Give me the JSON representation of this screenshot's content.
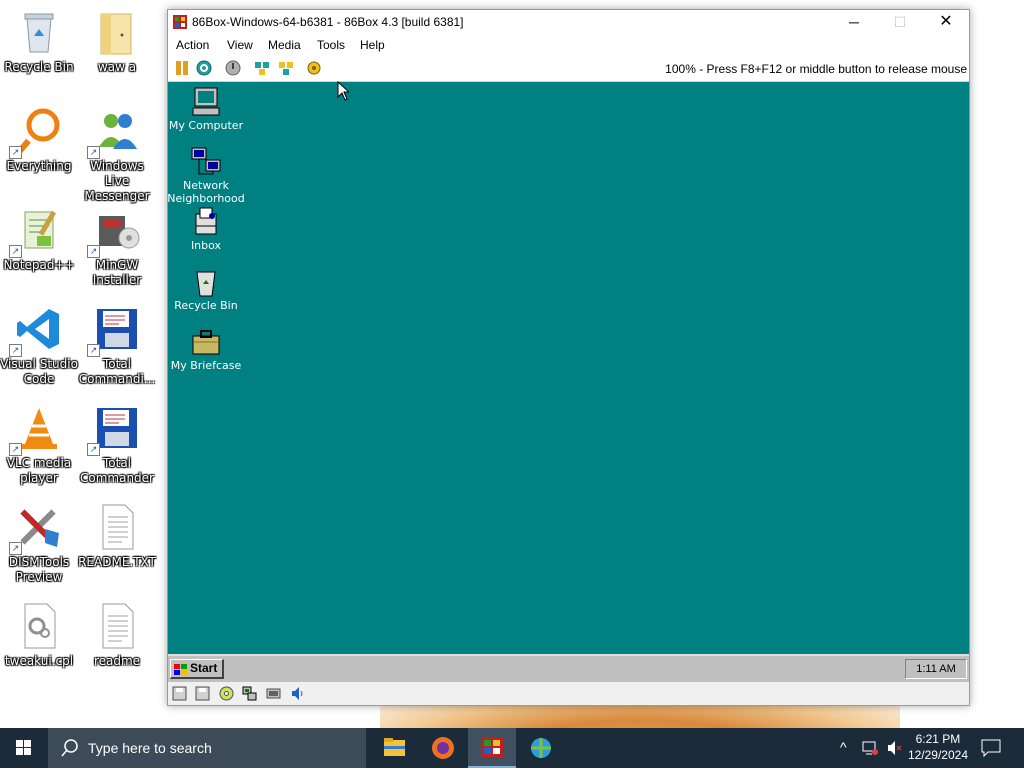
{
  "host_desktop": {
    "icons": [
      {
        "label": "Recycle Bin",
        "icon": "recycle-bin-icon"
      },
      {
        "label": "waw a",
        "icon": "folder-icon"
      },
      {
        "label": "Everything",
        "icon": "magnifier-app-icon"
      },
      {
        "label": "Windows Live Messenger",
        "icon": "messenger-icon"
      },
      {
        "label": "Notepad++",
        "icon": "notepadpp-icon"
      },
      {
        "label": "MinGW Installer",
        "icon": "installer-icon"
      },
      {
        "label": "Visual Studio Code",
        "icon": "vscode-icon"
      },
      {
        "label": "Total Commandi...",
        "icon": "floppy-icon"
      },
      {
        "label": "VLC media player",
        "icon": "vlc-icon"
      },
      {
        "label": "Total Commander",
        "icon": "floppy-icon"
      },
      {
        "label": "DISMTools Preview",
        "icon": "tools-icon"
      },
      {
        "label": "README.TXT",
        "icon": "text-file-icon"
      },
      {
        "label": "tweakui.cpl",
        "icon": "cpl-file-icon"
      },
      {
        "label": "readme",
        "icon": "text-file-icon"
      }
    ]
  },
  "emulator": {
    "title": "86Box-Windows-64-b6381 - 86Box 4.3 [build 6381]",
    "menu": [
      "Action",
      "View",
      "Media",
      "Tools",
      "Help"
    ],
    "status_text": "100% - Press F8+F12 or middle button to release mouse",
    "toolbar_icons": [
      "pause-icon",
      "reset-icon",
      "power-icon",
      "ctrl-alt-del-icon",
      "ctrl-alt-esc-icon",
      "settings-icon"
    ],
    "statusbar_icons": [
      "floppy-drive-icon",
      "floppy-drive-icon",
      "cdrom-icon",
      "network-icon",
      "display-icon",
      "sound-icon"
    ]
  },
  "guest": {
    "background": "#008080",
    "icons": [
      {
        "label": "My Computer",
        "icon": "my-computer-icon"
      },
      {
        "label": "Network Neighborhood",
        "icon": "network-neighborhood-icon"
      },
      {
        "label": "Inbox",
        "icon": "inbox-icon"
      },
      {
        "label": "Recycle Bin",
        "icon": "recycle-bin-icon"
      },
      {
        "label": "My Briefcase",
        "icon": "briefcase-icon"
      }
    ],
    "start_label": "Start",
    "clock": "1:11 AM"
  },
  "host_taskbar": {
    "search_placeholder": "Type here to search",
    "apps": [
      "file-explorer-icon",
      "firefox-icon",
      "86box-icon",
      "network-app-icon"
    ],
    "time": "6:21 PM",
    "date": "12/29/2024"
  }
}
